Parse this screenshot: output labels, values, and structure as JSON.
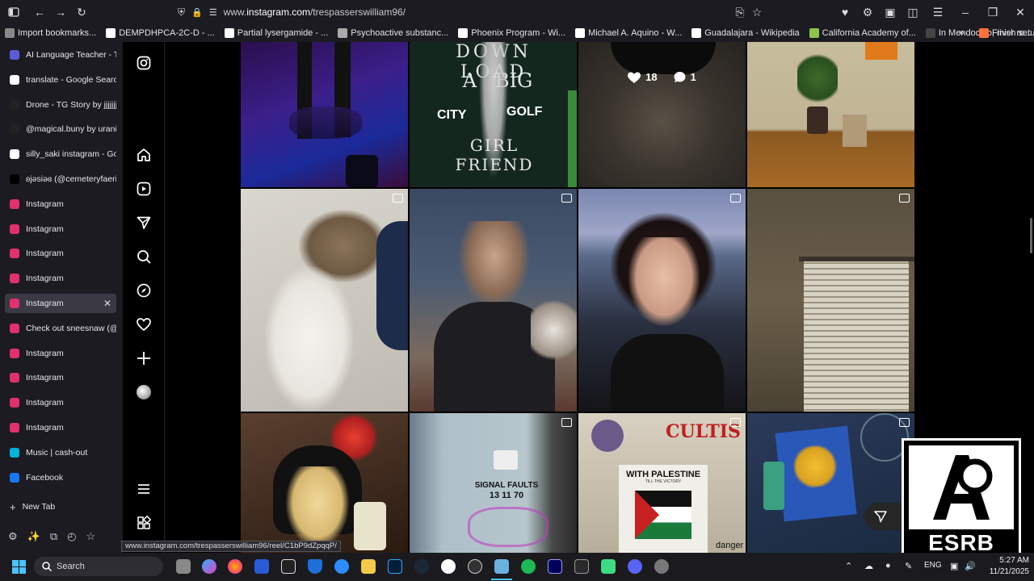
{
  "browser": {
    "url_prefix": "www.",
    "url_domain": "instagram.com",
    "url_path": "/trespasserswilliam96/",
    "status_url": "www.instagram.com/trespasserswilliam96/reel/C1bP9dZpqqP/"
  },
  "bookmarks": [
    {
      "label": "Import bookmarks...",
      "color": "#888888",
      "icon": "import-icon"
    },
    {
      "label": "DEMPDHPCA-2C-D - ...",
      "color": "#ffffff",
      "icon": "wikipedia-icon"
    },
    {
      "label": "Partial lysergamide - ...",
      "color": "#ffffff",
      "icon": "wikipedia-icon"
    },
    {
      "label": "Psychoactive substanc...",
      "color": "#aaaaaa",
      "icon": "site-icon"
    },
    {
      "label": "Phoenix Program - Wi...",
      "color": "#ffffff",
      "icon": "wikipedia-icon"
    },
    {
      "label": "Michael A. Aquino - W...",
      "color": "#ffffff",
      "icon": "wikipedia-icon"
    },
    {
      "label": "Guadalajara - Wikipedia",
      "color": "#ffffff",
      "icon": "wikipedia-icon"
    },
    {
      "label": "California Academy of...",
      "color": "#8bc34a",
      "icon": "site-icon"
    },
    {
      "label": "In Mendocino, river re...",
      "color": "#444444",
      "icon": "site-icon"
    },
    {
      "label": "Finish setup",
      "color": "#ff7139",
      "icon": "firefox-icon"
    }
  ],
  "tabs": [
    {
      "label": "AI Language Teacher - Talk",
      "color": "#5b5bd6",
      "icon": "ai-icon"
    },
    {
      "label": "translate - Google Search",
      "color": "#ffffff",
      "icon": "google-icon"
    },
    {
      "label": "Drone - TG Story by jjjjjjjjjjjjj",
      "color": "#222222",
      "icon": "ai-icon"
    },
    {
      "label": "@magical.buny by uranium",
      "color": "#222222",
      "icon": "ai-icon"
    },
    {
      "label": "silly_saki instagram - Goog",
      "color": "#ffffff",
      "icon": "google-icon"
    },
    {
      "label": "ʚjǝsiǝɞ (@cemeteryfaerie) ...",
      "color": "#000000",
      "icon": "x-icon"
    },
    {
      "label": "Instagram",
      "color": "#e1306c",
      "icon": "instagram-icon"
    },
    {
      "label": "Instagram",
      "color": "#e1306c",
      "icon": "instagram-icon"
    },
    {
      "label": "Instagram",
      "color": "#e1306c",
      "icon": "instagram-icon"
    },
    {
      "label": "Instagram",
      "color": "#e1306c",
      "icon": "instagram-icon"
    },
    {
      "label": "Instagram",
      "color": "#e1306c",
      "icon": "instagram-icon",
      "active": true
    },
    {
      "label": "Check out sneesnaw (@sn",
      "color": "#e1306c",
      "icon": "instagram-icon"
    },
    {
      "label": "Instagram",
      "color": "#e1306c",
      "icon": "instagram-icon"
    },
    {
      "label": "Instagram",
      "color": "#e1306c",
      "icon": "instagram-icon"
    },
    {
      "label": "Instagram",
      "color": "#e1306c",
      "icon": "instagram-icon"
    },
    {
      "label": "Instagram",
      "color": "#e1306c",
      "icon": "instagram-icon"
    },
    {
      "label": "Music | cash-out",
      "color": "#00b4d8",
      "icon": "music-icon"
    },
    {
      "label": "Facebook",
      "color": "#1877f2",
      "icon": "facebook-icon"
    }
  ],
  "new_tab_label": "New Tab",
  "post_overlay": {
    "likes": "18",
    "comments": "1"
  },
  "poster_text": {
    "top": "DOWN LOAD",
    "a_big": "A   BIG",
    "city": "CITY",
    "golf": "GOLF",
    "bottom": "GIRL FRIEND"
  },
  "sign_text": {
    "line1": "SIGNAL FAULTS",
    "line2": "13 11 70"
  },
  "palestine_text": {
    "headline": "WITH PALESTINE",
    "sub": "TILL THE VICTORY",
    "banner": "CULTIS",
    "footer": "danger"
  },
  "esrb": {
    "label": "ESRB"
  },
  "taskbar": {
    "search_label": "Search",
    "lang": "ENG",
    "time": "5:27 AM",
    "date": "11/21/2025"
  },
  "colors": {
    "accent": "#e1306c",
    "bg": "#000000",
    "chrome": "#1c1b22"
  }
}
